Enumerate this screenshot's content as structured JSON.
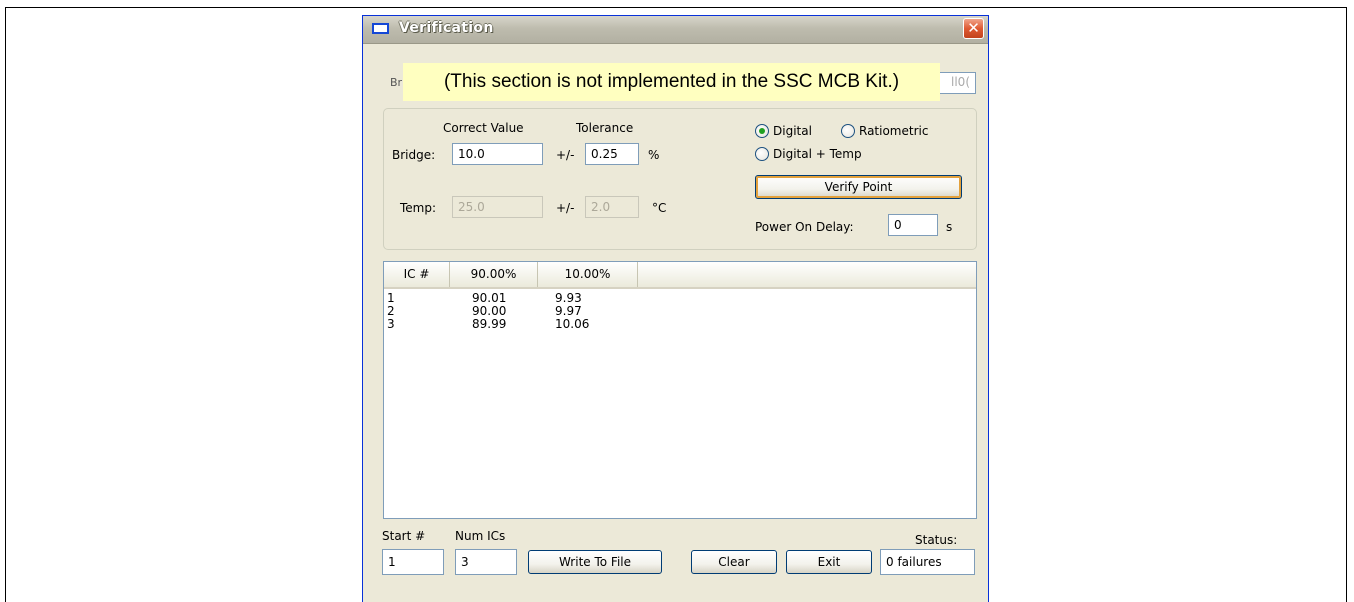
{
  "window": {
    "title": "Verification",
    "close_glyph": "✕"
  },
  "banner": {
    "text": "(This section is not implemented in the SSC MCB Kit.)"
  },
  "hidden_row": {
    "label_fragment": "Bri",
    "right_fragment": "ll0("
  },
  "values_group": {
    "correct_value_header": "Correct Value",
    "tolerance_header": "Tolerance",
    "bridge": {
      "label": "Bridge:",
      "value": "10.0",
      "pm": "+/-",
      "tolerance": "0.25",
      "unit": "%"
    },
    "temp": {
      "label": "Temp:",
      "value": "25.0",
      "pm": "+/-",
      "tolerance": "2.0",
      "unit": "°C"
    },
    "mode": {
      "selected": "Digital",
      "options": [
        "Digital",
        "Ratiometric",
        "Digital + Temp"
      ]
    },
    "verify_button": "Verify Point",
    "power_on_delay": {
      "label": "Power On Delay:",
      "value": "0",
      "unit": "s"
    }
  },
  "results_table": {
    "columns": [
      "IC #",
      "90.00%",
      "10.00%"
    ],
    "rows": [
      [
        "1",
        "90.01",
        "9.93"
      ],
      [
        "2",
        "90.00",
        "9.97"
      ],
      [
        "3",
        "89.99",
        "10.06"
      ]
    ]
  },
  "footer": {
    "start_label": "Start #",
    "start_value": "1",
    "num_ics_label": "Num ICs",
    "num_ics_value": "3",
    "write_button": "Write To File",
    "clear_button": "Clear",
    "exit_button": "Exit",
    "status_label": "Status:",
    "status_value": "0 failures"
  },
  "colors": {
    "window_bg": "#ece9d8",
    "titlebar": "#bebcae",
    "close_button": "#df5a33",
    "banner_bg": "#ffffc0",
    "radio_checked": "#21a121"
  }
}
